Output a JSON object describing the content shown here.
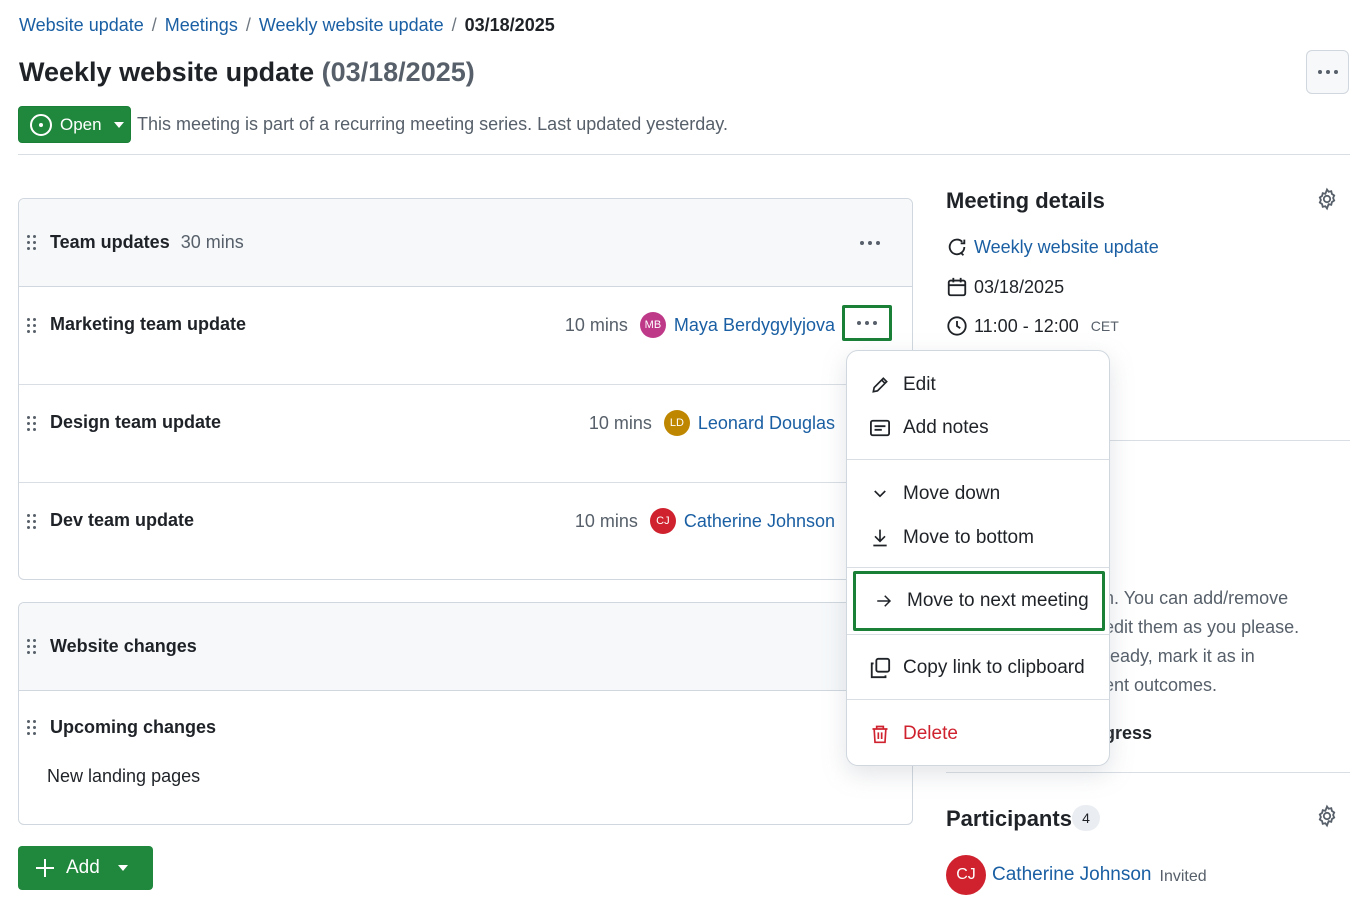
{
  "breadcrumb": {
    "items": [
      "Website update",
      "Meetings",
      "Weekly website update"
    ],
    "current": "03/18/2025",
    "separator": "/"
  },
  "page": {
    "title": "Weekly website update",
    "title_date": "(03/18/2025)"
  },
  "status": {
    "label": "Open",
    "description": "This meeting is part of a recurring meeting series. Last updated yesterday."
  },
  "agenda": {
    "sections": [
      {
        "title": "Team updates",
        "duration": "30 mins",
        "items": [
          {
            "title": "Marketing team update",
            "duration": "10 mins",
            "initials": "MB",
            "presenter": "Maya Berdygylyjova",
            "avatar_color": "#bf3989"
          },
          {
            "title": "Design team update",
            "duration": "10 mins",
            "initials": "LD",
            "presenter": "Leonard Douglas",
            "avatar_color": "#bf8700"
          },
          {
            "title": "Dev team update",
            "duration": "10 mins",
            "initials": "CJ",
            "presenter": "Catherine Johnson",
            "avatar_color": "#cf222e"
          }
        ]
      },
      {
        "title": "Website changes",
        "items": [
          {
            "title": "Upcoming changes",
            "note": "New landing pages"
          }
        ]
      }
    ],
    "add_label": "Add"
  },
  "details": {
    "title": "Meeting details",
    "series_link": "Weekly website update",
    "date": "03/18/2025",
    "time": "11:00 - 12:00",
    "timezone": "CET"
  },
  "side_partial": {
    "line1": "n. You can add/remove",
    "line2": "edit them as you please.",
    "line3": "ready, mark it as in",
    "line4": "ent outcomes.",
    "bold_fragment": "gress"
  },
  "participants": {
    "title": "Participants",
    "count": "4",
    "list": [
      {
        "initials": "CJ",
        "name": "Catherine Johnson",
        "status": "Invited",
        "avatar_color": "#cf222e"
      }
    ]
  },
  "context_menu": {
    "edit": "Edit",
    "add_notes": "Add notes",
    "move_down": "Move down",
    "move_to_bottom": "Move to bottom",
    "move_to_next_meeting": "Move to next meeting",
    "copy_link": "Copy link to clipboard",
    "delete": "Delete"
  },
  "colors": {
    "primary_green": "#1f883d",
    "link_blue": "#1a5fa3",
    "danger_red": "#cf222e",
    "focus_outline": "#1a7f37"
  }
}
